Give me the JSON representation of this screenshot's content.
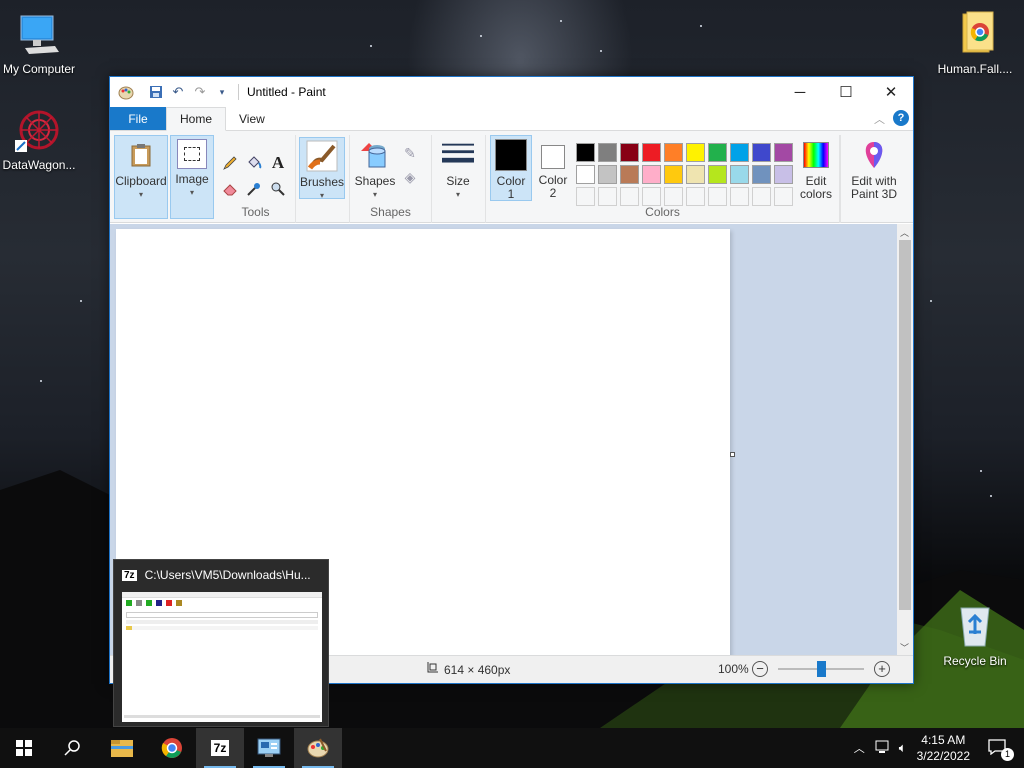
{
  "desktop": {
    "icons": [
      {
        "label": "My Computer"
      },
      {
        "label": "DataWagon..."
      },
      {
        "label": "Human.Fall...."
      },
      {
        "label": "Recycle Bin"
      }
    ]
  },
  "paint": {
    "title": "Untitled - Paint",
    "tabs": [
      "File",
      "Home",
      "View"
    ],
    "ribbon": {
      "clipboard": "Clipboard",
      "image": "Image",
      "tools_label": "Tools",
      "brushes": "Brushes",
      "shapes": "Shapes",
      "shapes_label": "Shapes",
      "size": "Size",
      "color1_line1": "Color",
      "color1_line2": "1",
      "color2_line1": "Color",
      "color2_line2": "2",
      "colors_label": "Colors",
      "edit_colors_line1": "Edit",
      "edit_colors_line2": "colors",
      "paint3d_line1": "Edit with",
      "paint3d_line2": "Paint 3D"
    },
    "palette_row1": [
      "#000000",
      "#7f7f7f",
      "#880015",
      "#ed1c24",
      "#ff7f27",
      "#fff200",
      "#22b14c",
      "#00a2e8",
      "#3f48cc",
      "#a349a4"
    ],
    "palette_row2": [
      "#ffffff",
      "#c3c3c3",
      "#b97a57",
      "#ffaec9",
      "#ffc90e",
      "#efe4b0",
      "#b5e61d",
      "#99d9ea",
      "#7092be",
      "#c8bfe7"
    ],
    "status": {
      "dimensions": "614 × 460px",
      "zoom": "100%"
    }
  },
  "thumbnail": {
    "title": "C:\\Users\\VM5\\Downloads\\Hu..."
  },
  "taskbar": {
    "time": "4:15 AM",
    "date": "3/22/2022",
    "notification_count": "1"
  }
}
